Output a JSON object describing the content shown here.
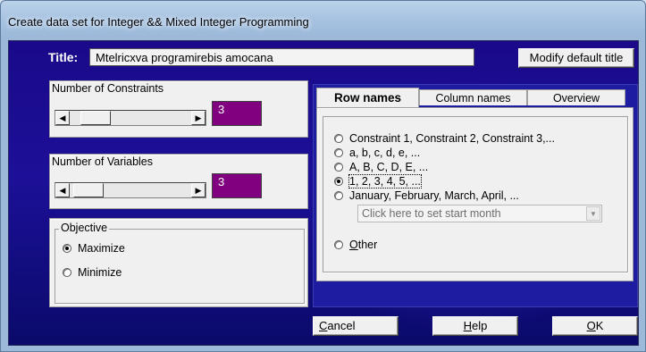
{
  "window": {
    "title": "Create data set for Integer && Mixed Integer Programming"
  },
  "title_field": {
    "label": "Title:",
    "value": "Mtelricxva programirebis amocana"
  },
  "buttons": {
    "modify_default_title": "Modify default title",
    "cancel_rest": "ancel",
    "cancel_mnemonic": "C",
    "help_rest": "elp",
    "help_mnemonic": "H",
    "ok_rest": "K",
    "ok_mnemonic": "O"
  },
  "constraints": {
    "label": "Number of Constraints",
    "value": "3"
  },
  "variables": {
    "label": "Number of Variables",
    "value": "3"
  },
  "objective": {
    "legend": "Objective",
    "options": [
      {
        "label": "Maximize",
        "checked": true
      },
      {
        "label": "Minimize",
        "checked": false
      }
    ]
  },
  "tabs": [
    {
      "label": "Row names",
      "active": true
    },
    {
      "label": "Column names",
      "active": false
    },
    {
      "label": "Overview",
      "active": false
    }
  ],
  "row_names": {
    "options": [
      {
        "label": "Constraint 1, Constraint 2, Constraint 3,...",
        "checked": false
      },
      {
        "label": "a, b, c, d, e, ...",
        "checked": false
      },
      {
        "label": "A, B, C, D, E, ...",
        "checked": false
      },
      {
        "label": "1, 2, 3, 4, 5, ...",
        "checked": true
      },
      {
        "label": "January, February, March, April, ...",
        "checked": false
      }
    ],
    "month_dropdown_placeholder": "Click here to set start month",
    "other_label_mnemonic": "O",
    "other_label_rest": "ther"
  },
  "colors": {
    "value_box": "#800080",
    "client_background": "#1c1098"
  },
  "icons": {
    "scroll_left": "triangle-left",
    "scroll_right": "triangle-right",
    "dropdown_arrow": "triangle-down"
  }
}
